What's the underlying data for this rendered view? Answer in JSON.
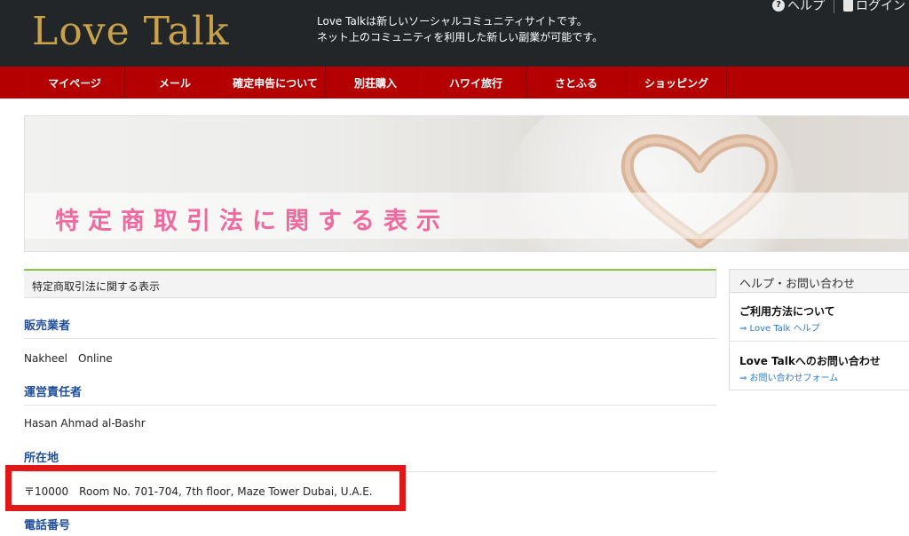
{
  "header": {
    "logo": "Love Talk",
    "tagline_1": "Love Talkは新しいソーシャルコミュニティサイトです。",
    "tagline_2": "ネット上のコミュニティを利用した新しい副業が可能です。",
    "help_label": "ヘルプ",
    "login_label": "ログイン",
    "colors": {
      "header_bg": "#222629",
      "logo": "#c9a14a"
    }
  },
  "nav": {
    "items": [
      {
        "label": "マイページ"
      },
      {
        "label": "メール"
      },
      {
        "label": "確定申告について"
      },
      {
        "label": "別荘購入"
      },
      {
        "label": "ハワイ旅行"
      },
      {
        "label": "さとふる"
      },
      {
        "label": "ショッピング"
      }
    ],
    "colors": {
      "bg": "#b40000"
    }
  },
  "hero": {
    "title": "特定商取引法に関する表示",
    "title_color": "#f06aa0"
  },
  "main": {
    "section_title": "特定商取引法に関する表示",
    "fields": [
      {
        "label": "販売業者",
        "value": "Nakheel　Online"
      },
      {
        "label": "運営責任者",
        "value": "Hasan Ahmad al-Bashr"
      },
      {
        "label": "所在地",
        "value": "〒10000　Room No. 701-704, 7th floor, Maze Tower Dubai, U.A.E."
      },
      {
        "label": "電話番号",
        "value": ""
      }
    ],
    "colors": {
      "label": "#1f4f9c",
      "accent_border": "#8bc34a",
      "highlight": "#e01818"
    }
  },
  "sidebar": {
    "heading": "ヘルプ・お問い合わせ",
    "items": [
      {
        "title": "ご利用方法について",
        "link": "⇒ Love Talk ヘルプ"
      },
      {
        "title": "Love Talkへのお問い合わせ",
        "link": "⇒ お問い合わせフォーム"
      }
    ],
    "colors": {
      "link": "#2a7bd1"
    }
  }
}
